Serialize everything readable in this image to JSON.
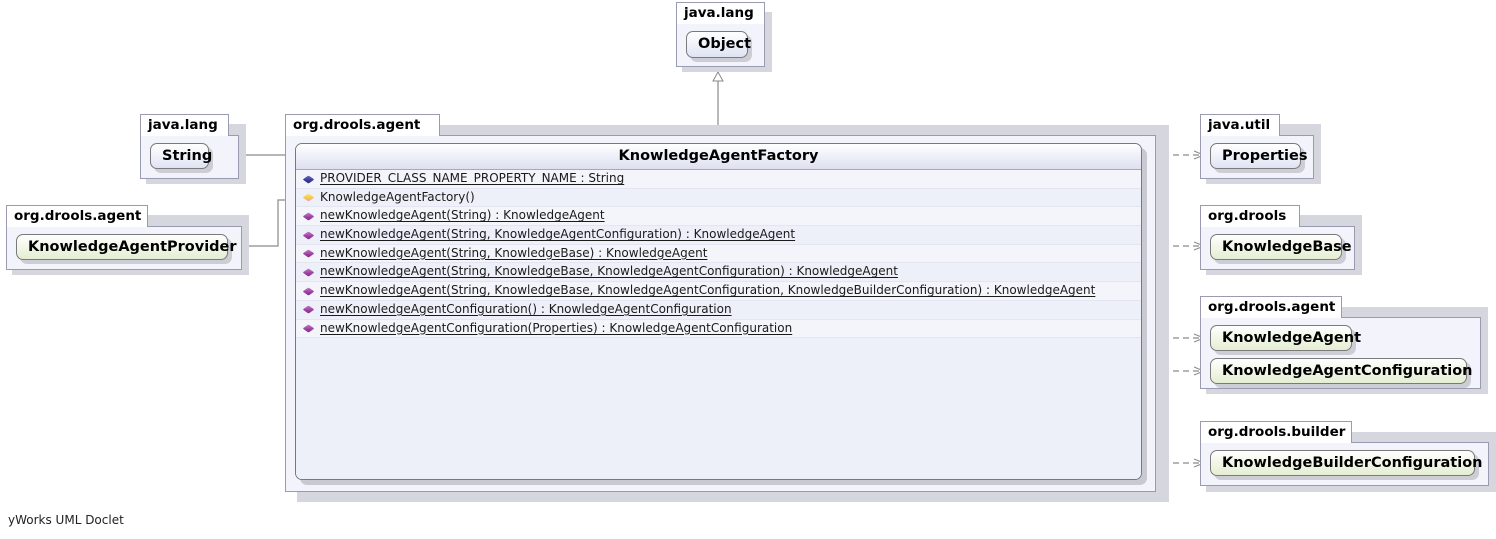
{
  "diagram": {
    "watermark": "yWorks UML Doclet",
    "main_class": {
      "name": "KnowledgeAgentFactory",
      "package": "org.drools.agent",
      "members": [
        {
          "icon": "field-icon",
          "kind": "static-field",
          "text": "PROVIDER_CLASS_NAME_PROPERTY_NAME : String",
          "static": true
        },
        {
          "icon": "ctor-icon",
          "kind": "constructor",
          "text": "KnowledgeAgentFactory()",
          "static": false
        },
        {
          "icon": "method-icon",
          "kind": "static-method",
          "text": "newKnowledgeAgent(String) : KnowledgeAgent",
          "static": true
        },
        {
          "icon": "method-icon",
          "kind": "static-method",
          "text": "newKnowledgeAgent(String, KnowledgeAgentConfiguration) : KnowledgeAgent",
          "static": true
        },
        {
          "icon": "method-icon",
          "kind": "static-method",
          "text": "newKnowledgeAgent(String, KnowledgeBase) : KnowledgeAgent",
          "static": true
        },
        {
          "icon": "method-icon",
          "kind": "static-method",
          "text": "newKnowledgeAgent(String, KnowledgeBase, KnowledgeAgentConfiguration) : KnowledgeAgent",
          "static": true
        },
        {
          "icon": "method-icon",
          "kind": "static-method",
          "text": "newKnowledgeAgent(String, KnowledgeBase, KnowledgeAgentConfiguration, KnowledgeBuilderConfiguration) : KnowledgeAgent",
          "static": true
        },
        {
          "icon": "method-icon",
          "kind": "static-method",
          "text": "newKnowledgeAgentConfiguration() : KnowledgeAgentConfiguration",
          "static": true
        },
        {
          "icon": "method-icon",
          "kind": "static-method",
          "text": "newKnowledgeAgentConfiguration(Properties) : KnowledgeAgentConfiguration",
          "static": true
        }
      ]
    },
    "packages": [
      {
        "id": "pkg-java-lang-object",
        "label": "java.lang",
        "classes": [
          "Object"
        ]
      },
      {
        "id": "pkg-java-lang-string",
        "label": "java.lang",
        "classes": [
          "String"
        ]
      },
      {
        "id": "pkg-org-drools-agent-left",
        "label": "org.drools.agent",
        "classes": [
          "KnowledgeAgentProvider"
        ]
      },
      {
        "id": "pkg-java-util",
        "label": "java.util",
        "classes": [
          "Properties"
        ]
      },
      {
        "id": "pkg-org-drools",
        "label": "org.drools",
        "classes": [
          "KnowledgeBase"
        ]
      },
      {
        "id": "pkg-org-drools-agent-right",
        "label": "org.drools.agent",
        "classes": [
          "KnowledgeAgent",
          "KnowledgeAgentConfiguration"
        ]
      },
      {
        "id": "pkg-org-drools-builder",
        "label": "org.drools.builder",
        "classes": [
          "KnowledgeBuilderConfiguration"
        ]
      }
    ],
    "relations": [
      {
        "from": "KnowledgeAgentFactory",
        "to": "Object",
        "type": "generalization"
      },
      {
        "from": "KnowledgeAgentFactory",
        "to": "String",
        "type": "association"
      },
      {
        "from": "KnowledgeAgentFactory",
        "to": "KnowledgeAgentProvider",
        "type": "association"
      },
      {
        "from": "KnowledgeAgentFactory",
        "to": "Properties",
        "type": "dependency"
      },
      {
        "from": "KnowledgeAgentFactory",
        "to": "KnowledgeBase",
        "type": "dependency"
      },
      {
        "from": "KnowledgeAgentFactory",
        "to": "KnowledgeAgent",
        "type": "dependency"
      },
      {
        "from": "KnowledgeAgentFactory",
        "to": "KnowledgeAgentConfiguration",
        "type": "dependency"
      },
      {
        "from": "KnowledgeAgentFactory",
        "to": "KnowledgeBuilderConfiguration",
        "type": "dependency"
      }
    ],
    "colors": {
      "package_fill": "#f3f4fb",
      "class_fill": "#eef0f9",
      "reference_green": "#e4eed3",
      "reference_blue": "#dfe3f2",
      "edge": "#8a8a8a",
      "border": "#767684"
    },
    "labels": {
      "pkg_object": "java.lang",
      "cls_object": "Object",
      "pkg_string": "java.lang",
      "cls_string": "String",
      "pkg_provider": "org.drools.agent",
      "cls_provider": "KnowledgeAgentProvider",
      "pkg_util": "java.util",
      "cls_properties": "Properties",
      "pkg_drools": "org.drools",
      "cls_kbase": "KnowledgeBase",
      "pkg_agent_right": "org.drools.agent",
      "cls_kagent": "KnowledgeAgent",
      "cls_kagentconf": "KnowledgeAgentConfiguration",
      "pkg_builder": "org.drools.builder",
      "cls_kbuilderconf": "KnowledgeBuilderConfiguration",
      "pkg_main": "org.drools.agent",
      "cls_main": "KnowledgeAgentFactory"
    }
  }
}
